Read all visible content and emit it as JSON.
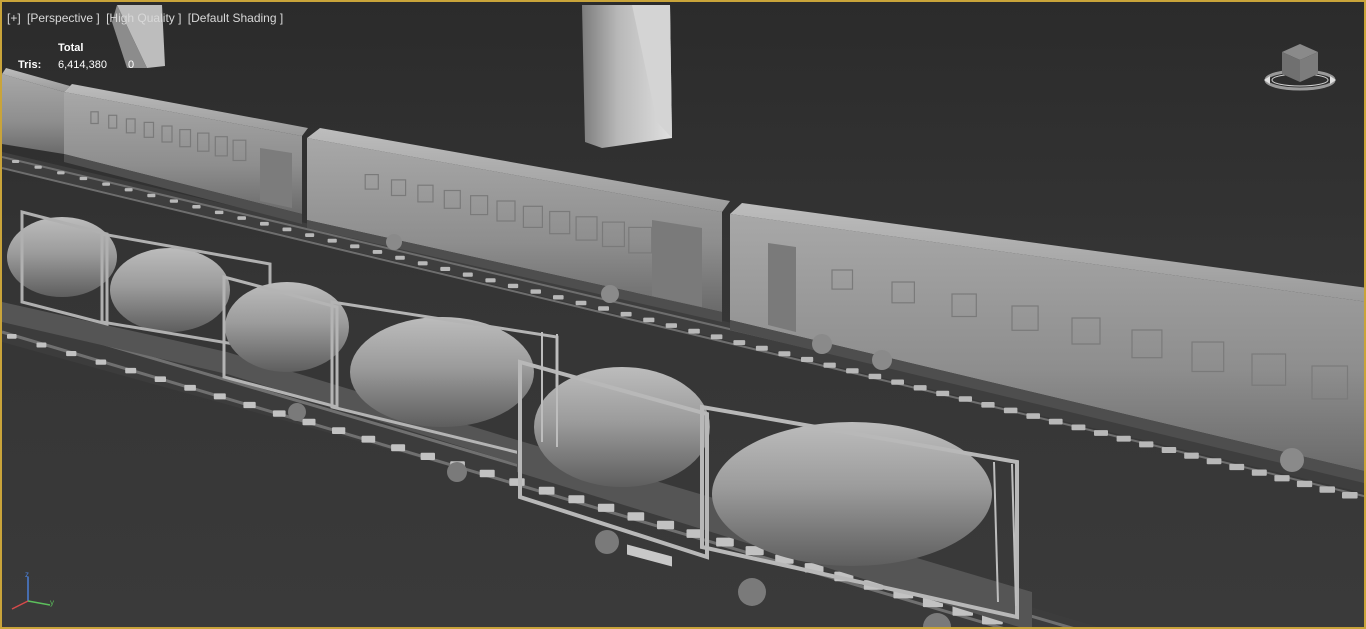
{
  "viewport": {
    "labels": [
      "[+]",
      "[Perspective ]",
      "[High Quality ]",
      "[Default Shading ]"
    ],
    "stats": {
      "header": "Total",
      "row_label": "Tris:",
      "total_value": "6,414,380",
      "selected_value": "0"
    },
    "viewcube": {
      "icon": "viewcube-icon"
    },
    "axis_gizmo": {
      "icon": "axis-tripod-icon"
    }
  },
  "colors": {
    "viewport_border": "#c9a43a",
    "background": "#2b2b2b",
    "model_gray": "#9a9a9a",
    "label_text": "#d8d8d8"
  }
}
